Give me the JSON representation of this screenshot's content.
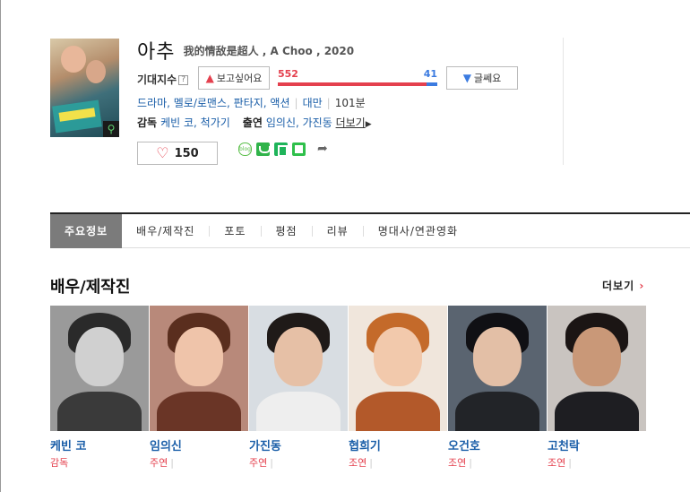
{
  "movie": {
    "title_ko": "아추",
    "title_sub": "我的情敌是超人 , A Choo , 2020",
    "expect_label": "기대지수",
    "want_label": "보고싶어요",
    "want_count": "552",
    "dont_label": "글쎄요",
    "dont_count": "41",
    "genres": [
      "드라마",
      "멜로/로맨스",
      "판타지",
      "액션"
    ],
    "country": "대만",
    "runtime": "101분",
    "director_label": "감독",
    "directors": "케빈 코, 척가기",
    "cast_label": "출연",
    "cast_names": "임의신, 가진동",
    "more_label": "더보기",
    "like_count": "150"
  },
  "tabs": [
    {
      "label": "주요정보"
    },
    {
      "label": "배우/제작진"
    },
    {
      "label": "포토"
    },
    {
      "label": "평점"
    },
    {
      "label": "리뷰"
    },
    {
      "label": "명대사/연관영화"
    }
  ],
  "section": {
    "title": "배우/제작진",
    "more_label": "더보기"
  },
  "cast": [
    {
      "name": "케빈 코",
      "role": "감독"
    },
    {
      "name": "임의신",
      "role": "주연"
    },
    {
      "name": "가진동",
      "role": "주연"
    },
    {
      "name": "협희기",
      "role": "조연"
    },
    {
      "name": "오건호",
      "role": "조연"
    },
    {
      "name": "고천락",
      "role": "조연"
    }
  ],
  "colors": {
    "like_red": "#e4404e",
    "dislike_blue": "#3b7be0",
    "link_blue": "#1a5ea8",
    "tab_active": "#7b7b7b"
  }
}
